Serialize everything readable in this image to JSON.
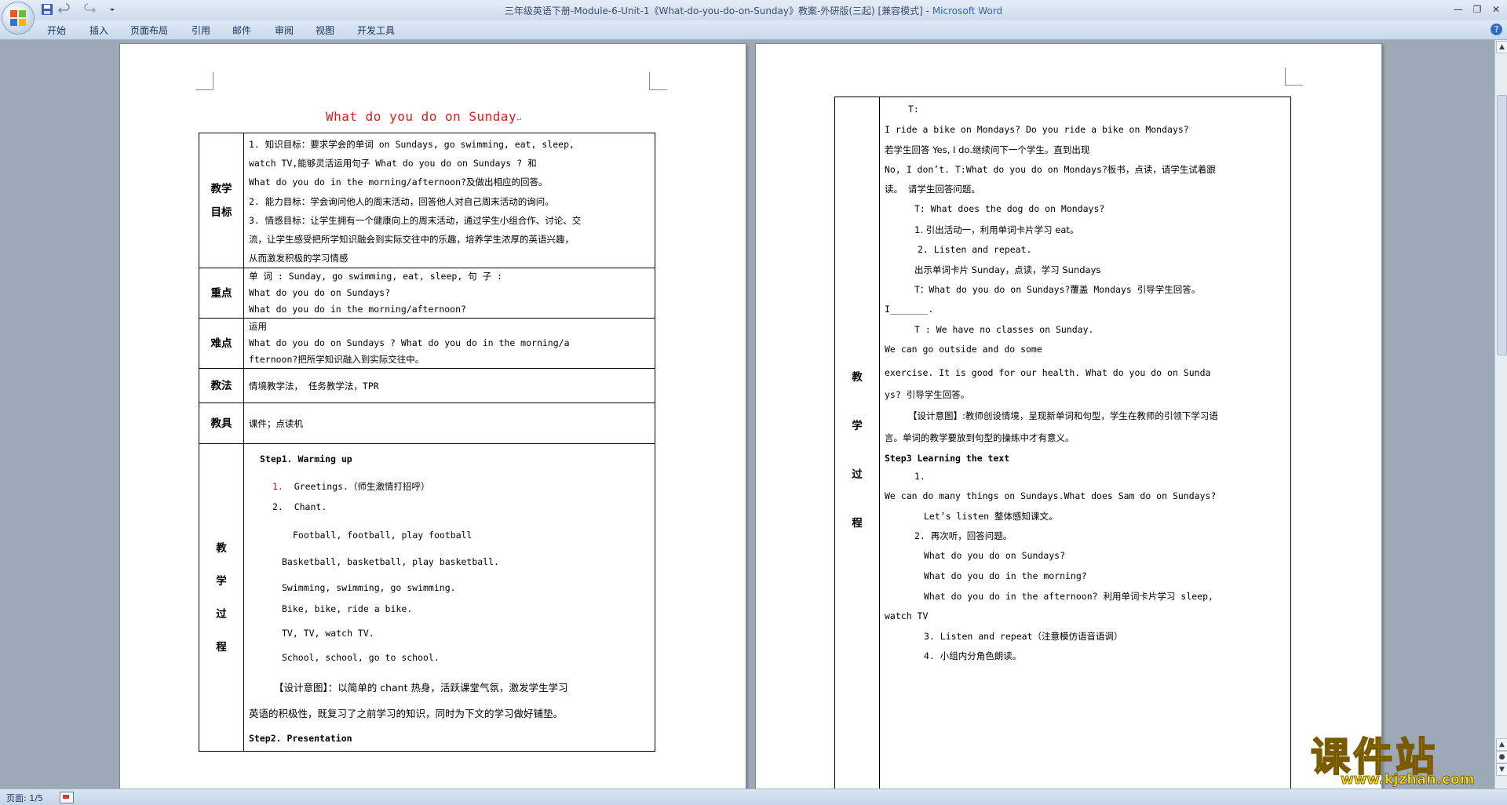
{
  "window": {
    "title": "三年级英语下册-Module-6-Unit-1《What-do-you-do-on-Sunday》教案-外研版(三起) [兼容模式] - ",
    "app_name": "Microsoft Word"
  },
  "ribbon": {
    "tabs": [
      "开始",
      "插入",
      "页面布局",
      "引用",
      "邮件",
      "审阅",
      "视图",
      "开发工具"
    ]
  },
  "statusbar": {
    "page": "页面: 1/5"
  },
  "watermark": {
    "text": "课件站",
    "url": "www.kjzhan.com"
  },
  "page1": {
    "heading": "What do you do on Sunday",
    "labels": {
      "goals": "教学目标",
      "key": "重点",
      "difficult": "难点",
      "method": "教法",
      "tools": "教具",
      "process": "教学过程"
    },
    "goals": [
      "1. 知识目标：要求学会的单词 on  Sundays, go  swimming, eat, sleep,",
      "watch  TV,能够灵活运用句子 What  do  you  do  on  Sundays  ?  和",
      "What  do  you  do  in  the  morning/afternoon?及做出相应的回答。",
      "2. 能力目标：学会询问他人的周末活动，回答他人对自己周末活动的询问。",
      "3. 情感目标：让学生拥有一个健康向上的周末活动，通过学生小组合作、讨论、交",
      "流，让学生感受把所学知识融会到实际交往中的乐趣，培养学生浓厚的英语兴趣，",
      "从而激发积极的学习情感"
    ],
    "key": [
      "单  词  :  Sunday,  go swimming,  eat,  sleep,  句 子 :",
      "What  do  you  do  on  Sundays?",
      "What  do  you  do  in  the  morning/afternoon?"
    ],
    "difficult": [
      "运用",
      "What  do  you  do  on  Sundays  ?  What  do  you  do  in  the  morning/a",
      "fternoon?把所学知识融入到实际交往中。"
    ],
    "method": "情境教学法， 任务教学法，TPR",
    "tools": "课件；点读机",
    "process": {
      "step1": "Step1. Warming up",
      "items": [
        "Greetings.（师生激情打招呼）",
        "Chant."
      ],
      "chant": [
        "Football,  football,  play  football",
        "Basketball, basketball,  play  basketball.",
        "Swimming,  swimming,  go  swimming.",
        "Bike,  bike,  ride  a bike.",
        "TV,  TV,  watch  TV.",
        "School,  school,  go  to  school."
      ],
      "design1": "【设计意图】：以简单的 chant 热身，活跃课堂气氛，激发学生学习",
      "design2": "英语的积极性，既复习了之前学习的知识，同时为下文的学习做好铺垫。",
      "step2": "Step2. Presentation"
    }
  },
  "page2": {
    "label": "教学过程",
    "lines": [
      "T:",
      "I  ride  a  bike  on  Mondays?  Do  you  ride  a  bike  on  Mondays?",
      "若学生回答 Yes, I  do.继续问下一个学生。直到出现",
      "No, I  don’t.  T:What  do  you  do  on  Mondays?板书，点读，请学生试着跟",
      "读。  请学生回答问题。",
      "T:  What  does  the  dog  do  on  Mondays?",
      "1. 引出活动一，利用单词卡片学习 eat。",
      "2. Listen  and  repeat.",
      "出示单词卡片 Sunday，点读，学习 Sundays",
      "T：What  do  you  do  on  Sundays?覆盖 Mondays  引导学生回答。",
      "I_______.",
      "T          :          We  have  no  classes  on  Sunday.",
      "We  can  go  outside  and  do  some",
      "exercise.  It  is  good  for  our  health.  What  do  you  do  on  Sunda",
      "ys?  引导学生回答。",
      "【设计意图】:教师创设情境，呈现新单词和句型，学生在教师的引领下学习语",
      "言。单词的教学要放到句型的操练中才有意义。",
      "Step3 Learning the text",
      "1.",
      "We  can  do  many  things  on  Sundays.What  does  Sam  do  on  Sundays?",
      "Let’s  listen  整体感知课文。",
      "2. 再次听，回答问题。",
      "What  do  you  do  on  Sundays?",
      "What  do  you  do  in  the  morning?",
      "What  do  you  do  in  the  afternoon?  利用单词卡片学习 sleep,",
      "watch TV",
      "3. Listen  and  repeat（注意模仿语音语调）",
      "4. 小组内分角色朗读。"
    ]
  }
}
